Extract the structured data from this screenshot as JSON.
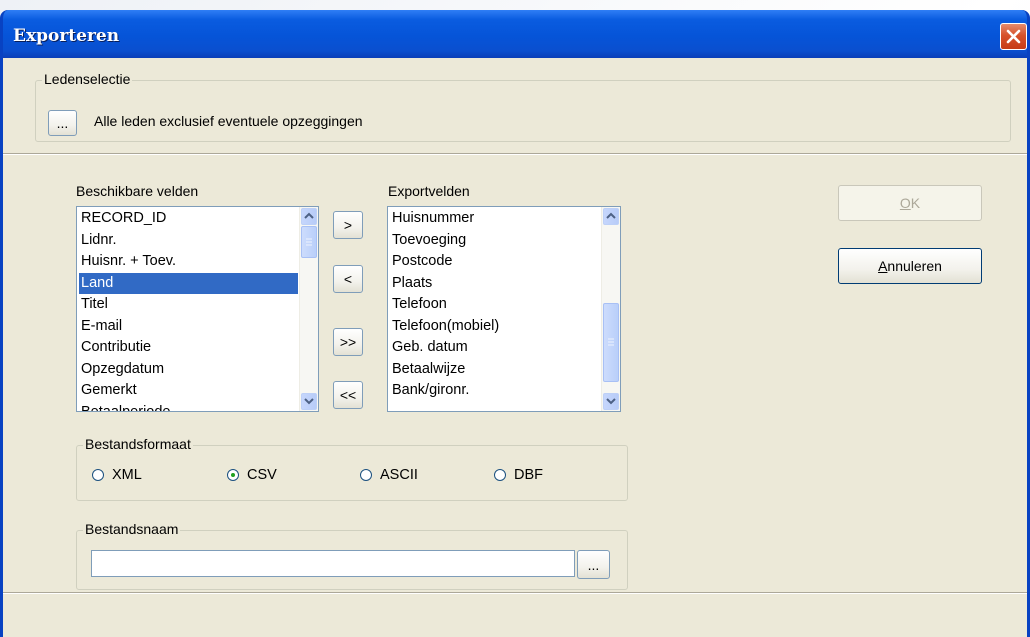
{
  "window": {
    "title": "Exporteren"
  },
  "ledenselectie": {
    "label": "Ledenselectie",
    "browse_label": "...",
    "text": "Alle leden exclusief eventuele opzeggingen"
  },
  "available_fields": {
    "label": "Beschikbare velden",
    "items": [
      "RECORD_ID",
      "Lidnr.",
      "Huisnr. + Toev.",
      "Land",
      "Titel",
      "E-mail",
      "Contributie",
      "Opzegdatum",
      "Gemerkt",
      "Betaalperiode"
    ],
    "selected": "Land"
  },
  "move_buttons": {
    "add": ">",
    "remove": "<",
    "add_all": ">>",
    "remove_all": "<<"
  },
  "export_fields": {
    "label": "Exportvelden",
    "items": [
      "Huisnummer",
      "Toevoeging",
      "Postcode",
      "Plaats",
      "Telefoon",
      "Telefoon(mobiel)",
      "Geb. datum",
      "Betaalwijze",
      "Bank/gironr."
    ]
  },
  "buttons": {
    "ok_prefix": "",
    "ok_mnemonic": "O",
    "ok_rest": "K",
    "cancel_mnemonic": "A",
    "cancel_rest": "nnuleren"
  },
  "file_format": {
    "label": "Bestandsformaat",
    "options": [
      "XML",
      "CSV",
      "ASCII",
      "DBF"
    ],
    "selected": "CSV"
  },
  "file_name": {
    "label": "Bestandsnaam",
    "value": "",
    "browse_label": "..."
  },
  "colors": {
    "title_bar": "#0a5ce0",
    "selection": "#316ac5",
    "dialog_bg": "#ece9d8",
    "close_red": "#d7522b"
  }
}
